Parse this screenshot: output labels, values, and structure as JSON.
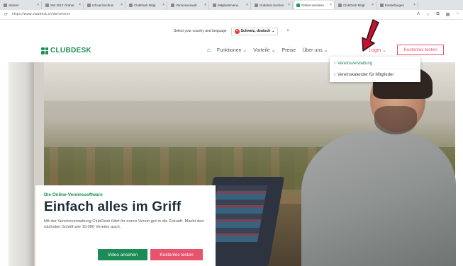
{
  "browser": {
    "tabs": [
      {
        "title": "obolum"
      },
      {
        "title": "SW 2017 Ordner"
      },
      {
        "title": "Infoverzeichnis"
      },
      {
        "title": "ClubDesk Mitgl."
      },
      {
        "title": "Vereinsverwalt."
      },
      {
        "title": "Mitgliederverw."
      },
      {
        "title": "clubdesk Suchen"
      },
      {
        "title": "Online-Vereinsv."
      },
      {
        "title": "ClubDesk Mitgl."
      },
      {
        "title": "Einstellungen"
      }
    ],
    "active_tab_index": 7,
    "url": "https://www.clubdesk.ch/de/vereine"
  },
  "site": {
    "lang_prompt": "Select your country and language",
    "lang_value": "Schweiz, deutsch",
    "lang_close": "×",
    "logo": "CLUBDESK",
    "nav": {
      "funktionen": "Funktionen ⌄",
      "vorteile": "Vorteile ⌄",
      "preise": "Preise",
      "ueber_uns": "Über uns ⌄"
    },
    "login": "Login ⌄",
    "trial_button": "Kostenlos testen",
    "dropdown": [
      "Vereinsverwaltung",
      "Vereinskalender für Mitglieder"
    ],
    "hero": {
      "eyebrow": "Die Online-Vereinssoftware",
      "headline": "Einfach alles im Griff",
      "lead": "Mit der Vereinsverwaltung ClubDesk führt ihr euren Verein gut in die Zukunft. Macht den nächsten Schritt wie 10.000 Vereine auch.",
      "video_button": "Video ansehen",
      "trial_button": "Kostenlos testen"
    }
  },
  "colors": {
    "brand_green": "#1c8c56",
    "accent_red": "#e8546d",
    "arrow_red": "#c8102e"
  },
  "icons": {
    "home": "home-icon",
    "flag": "swiss-flag-icon",
    "arrow": "red-arrow-annotation"
  }
}
